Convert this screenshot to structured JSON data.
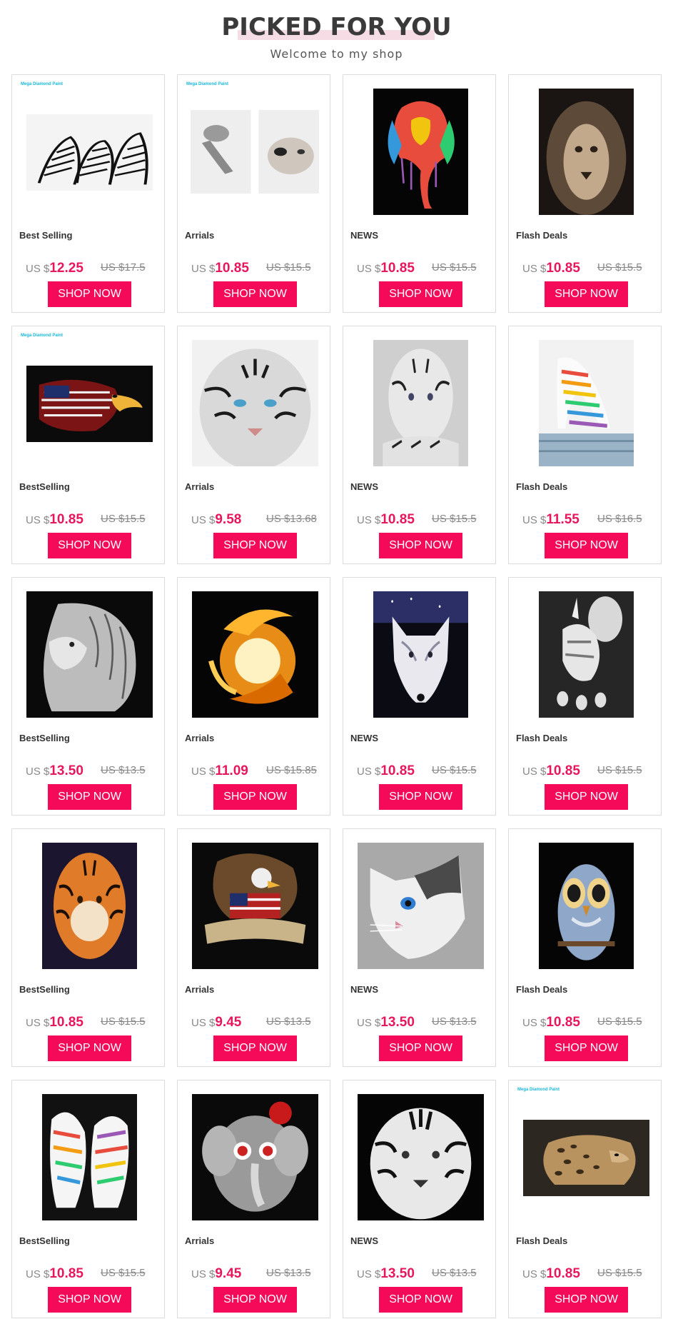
{
  "header": {
    "title": "PICKED FOR YOU",
    "subtitle": "Welcome to my shop"
  },
  "brand_watermark": "Mega Diamond Paint",
  "currency": "US $",
  "accent_color": "#f50a5a",
  "button_label": "SHOP NOW",
  "products": [
    {
      "category": "Best Selling",
      "price": "12.25",
      "old_price": "US $17.5",
      "brand": true,
      "image": "zebras-image"
    },
    {
      "category": "Arrials",
      "price": "10.85",
      "old_price": "US $15.5",
      "brand": true,
      "image": "kittens-image"
    },
    {
      "category": "NEWS",
      "price": "10.85",
      "old_price": "US $15.5",
      "brand": false,
      "image": "colorful-elephant-image"
    },
    {
      "category": "Flash Deals",
      "price": "10.85",
      "old_price": "US $15.5",
      "brand": false,
      "image": "lion-image"
    },
    {
      "category": "BestSelling",
      "price": "10.85",
      "old_price": "US $15.5",
      "brand": true,
      "image": "flag-eagle-image"
    },
    {
      "category": "Arrials",
      "price": "9.58",
      "old_price": "US $13.68",
      "brand": false,
      "image": "white-tiger-image"
    },
    {
      "category": "NEWS",
      "price": "10.85",
      "old_price": "US $15.5",
      "brand": false,
      "image": "tiger-lying-image"
    },
    {
      "category": "Flash Deals",
      "price": "11.55",
      "old_price": "US $16.5",
      "brand": false,
      "image": "rainbow-zebra-image"
    },
    {
      "category": "BestSelling",
      "price": "13.50",
      "old_price": "US $13.5",
      "brand": false,
      "image": "lion-profile-image"
    },
    {
      "category": "Arrials",
      "price": "11.09",
      "old_price": "US $15.85",
      "brand": false,
      "image": "phoenix-image"
    },
    {
      "category": "NEWS",
      "price": "10.85",
      "old_price": "US $15.5",
      "brand": false,
      "image": "wolf-image"
    },
    {
      "category": "Flash Deals",
      "price": "10.85",
      "old_price": "US $15.5",
      "brand": false,
      "image": "skeleton-unicorn-image"
    },
    {
      "category": "BestSelling",
      "price": "10.85",
      "old_price": "US $15.5",
      "brand": false,
      "image": "orange-tiger-image"
    },
    {
      "category": "Arrials",
      "price": "9.45",
      "old_price": "US $13.5",
      "brand": false,
      "image": "eagle-banner-image"
    },
    {
      "category": "NEWS",
      "price": "13.50",
      "old_price": "US $13.5",
      "brand": false,
      "image": "cat-image"
    },
    {
      "category": "Flash Deals",
      "price": "10.85",
      "old_price": "US $15.5",
      "brand": false,
      "image": "owl-image"
    },
    {
      "category": "BestSelling",
      "price": "10.85",
      "old_price": "US $15.5",
      "brand": false,
      "image": "rainbow-zebras-image"
    },
    {
      "category": "Arrials",
      "price": "9.45",
      "old_price": "US $13.5",
      "brand": false,
      "image": "sugar-skull-elephant-image"
    },
    {
      "category": "NEWS",
      "price": "13.50",
      "old_price": "US $13.5",
      "brand": false,
      "image": "tiger-face-image"
    },
    {
      "category": "Flash Deals",
      "price": "10.85",
      "old_price": "US $15.5",
      "brand": true,
      "image": "leopard-image"
    }
  ]
}
